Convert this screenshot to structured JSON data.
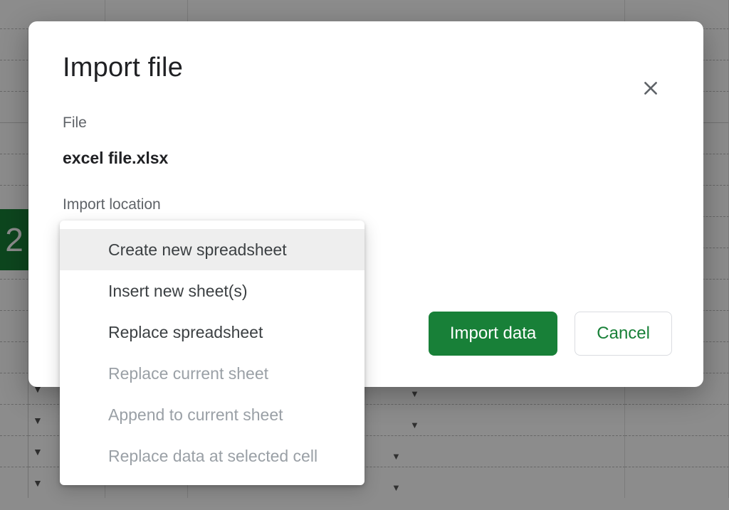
{
  "background": {
    "selected_row_number": "2"
  },
  "dialog": {
    "title": "Import file",
    "file_label": "File",
    "file_name": "excel file.xlsx",
    "import_location_label": "Import location",
    "import_button": "Import data",
    "cancel_button": "Cancel"
  },
  "dropdown": {
    "items": [
      {
        "label": "Create new spreadsheet",
        "selected": true,
        "disabled": false
      },
      {
        "label": "Insert new sheet(s)",
        "selected": false,
        "disabled": false
      },
      {
        "label": "Replace spreadsheet",
        "selected": false,
        "disabled": false
      },
      {
        "label": "Replace current sheet",
        "selected": false,
        "disabled": true
      },
      {
        "label": "Append to current sheet",
        "selected": false,
        "disabled": true
      },
      {
        "label": "Replace data at selected cell",
        "selected": false,
        "disabled": true
      }
    ]
  },
  "colors": {
    "primary": "#188038",
    "text_muted": "#5f6368"
  }
}
